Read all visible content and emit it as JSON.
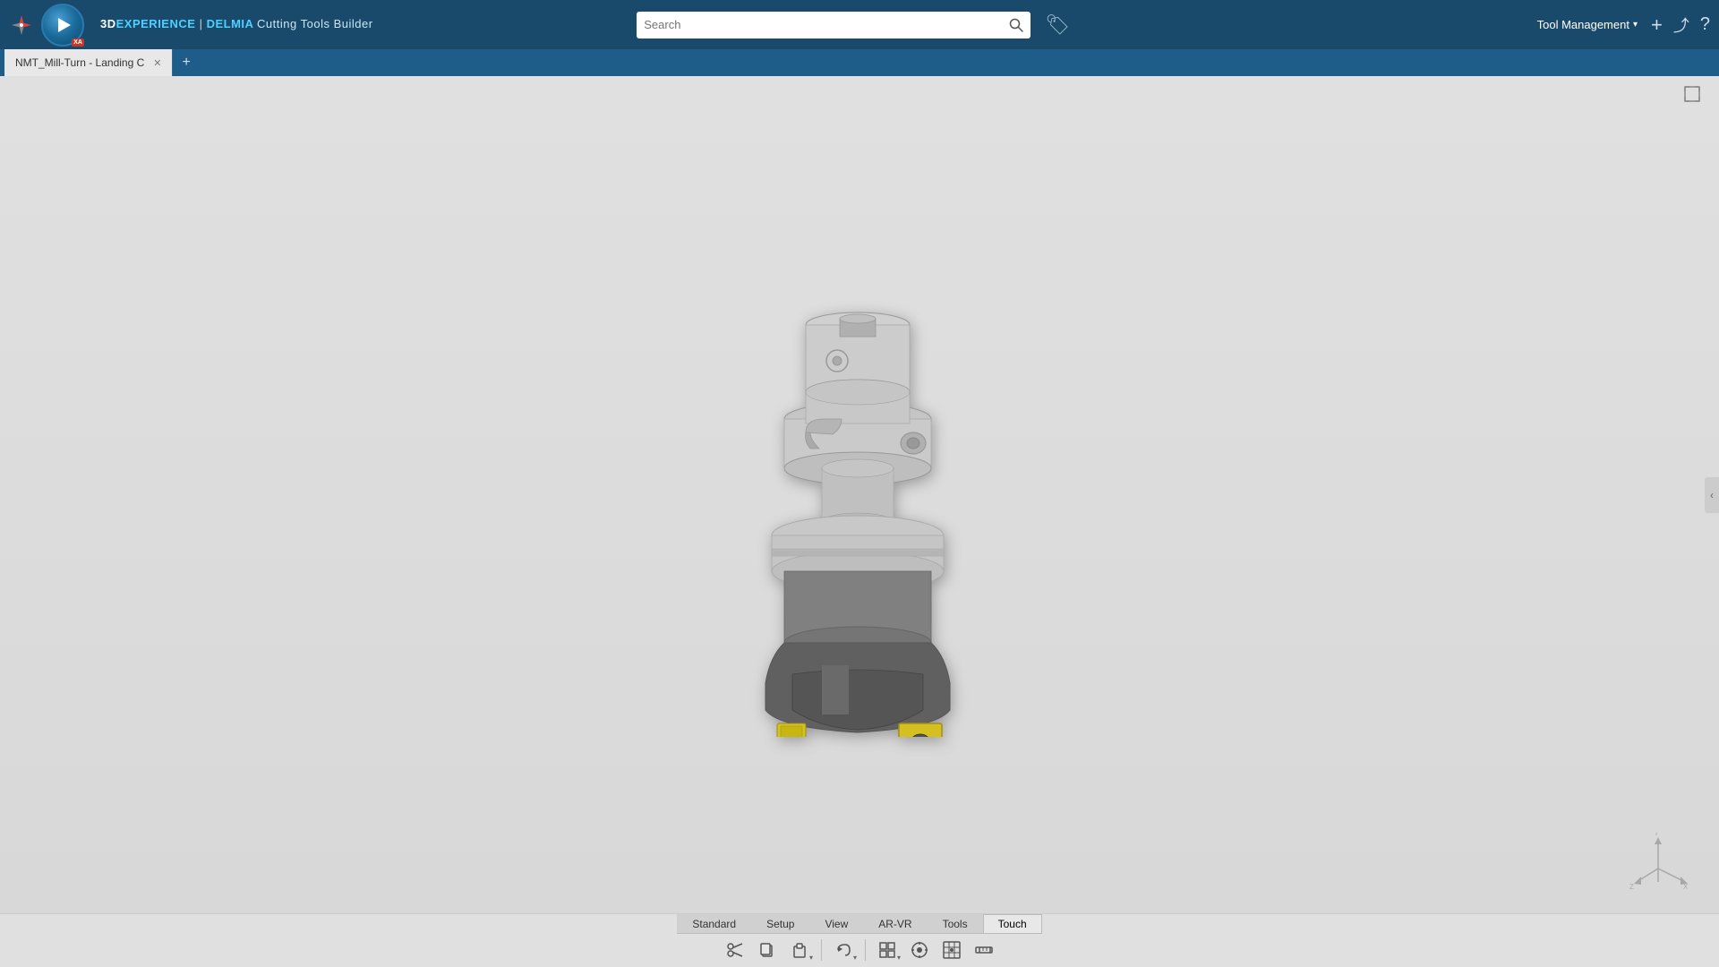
{
  "window": {
    "title": "3DEXPERIENCE"
  },
  "topbar": {
    "brand_prefix": "3D",
    "brand_experience": "EXPERIENCE",
    "brand_separator": " | ",
    "brand_delmia": "DELMIA",
    "brand_app": "Cutting Tools Builder",
    "play_label": "XA",
    "search_placeholder": "Search",
    "tag_icon": "🏷",
    "tool_management_label": "Tool Management",
    "add_icon": "+",
    "share_icon": "⤴",
    "help_icon": "?"
  },
  "tabbar": {
    "tabs": [
      {
        "label": "NMT_Mill-Turn - Landing C",
        "active": true,
        "closeable": true
      }
    ],
    "add_label": "+"
  },
  "toolbar": {
    "tabs": [
      {
        "label": "Standard",
        "active": false
      },
      {
        "label": "Setup",
        "active": false
      },
      {
        "label": "View",
        "active": false
      },
      {
        "label": "AR-VR",
        "active": false
      },
      {
        "label": "Tools",
        "active": false
      },
      {
        "label": "Touch",
        "active": true
      }
    ],
    "buttons": [
      {
        "icon": "✂",
        "has_dropdown": false,
        "name": "cut-button"
      },
      {
        "icon": "⬜",
        "has_dropdown": false,
        "name": "copy-button"
      },
      {
        "icon": "📋",
        "has_dropdown": true,
        "name": "paste-button"
      },
      {
        "icon": "↩",
        "has_dropdown": true,
        "name": "undo-button"
      },
      {
        "icon": "⊞",
        "has_dropdown": true,
        "name": "view-button"
      },
      {
        "icon": "⚙",
        "has_dropdown": false,
        "name": "settings-button"
      },
      {
        "icon": "🔲",
        "has_dropdown": false,
        "name": "grid-button"
      },
      {
        "icon": "📊",
        "has_dropdown": false,
        "name": "chart-button"
      }
    ]
  },
  "viewport": {
    "background": "#e0e0e0"
  },
  "axis": {
    "label": ""
  }
}
